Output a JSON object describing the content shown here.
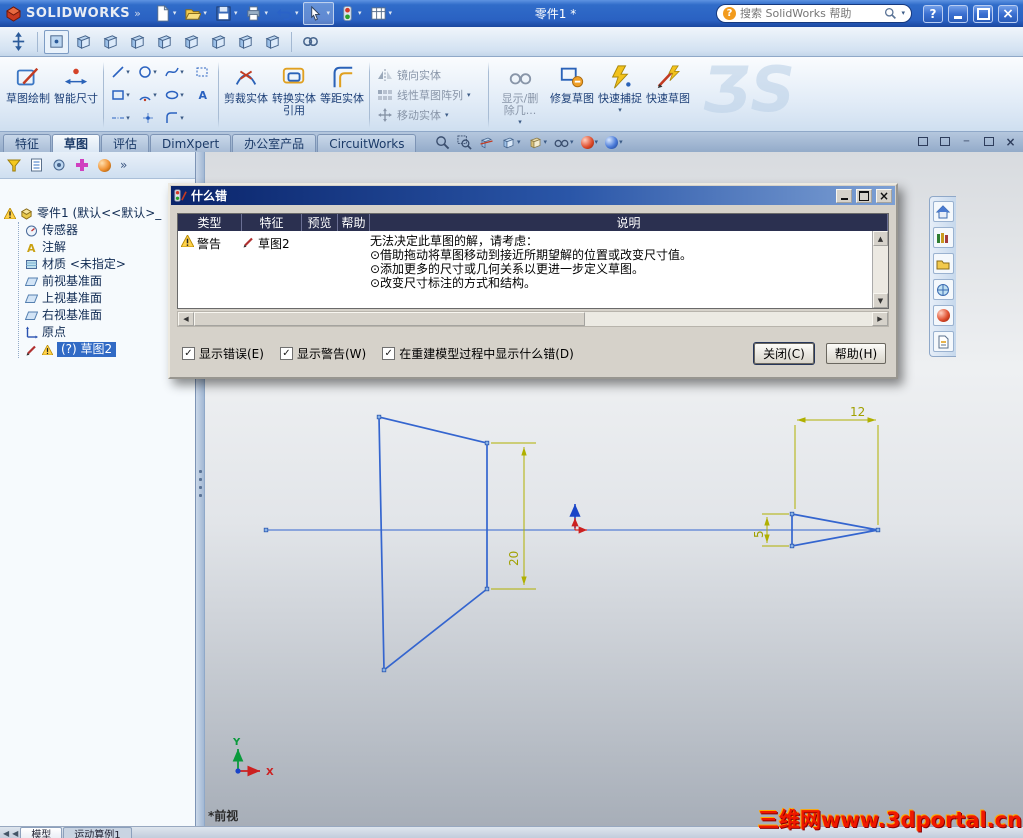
{
  "titlebar": {
    "brand": "SOLIDWORKS",
    "doc_title": "零件1 *",
    "search_placeholder": "搜索 SolidWorks 帮助"
  },
  "icons": {
    "help_badge": "?",
    "caret": "▾",
    "chevron": "»",
    "close": "×",
    "check": "✓",
    "warning": "yellow-triangle-exclamation",
    "search": "magnifier",
    "rebuild": "traffic-light"
  },
  "colors": {
    "titlebar_blue": "#2a61c2",
    "selection_blue": "#316ac5",
    "geometry_blue": "#3465cf",
    "dimension_yellow": "#b0b000",
    "warning_yellow": "#f4c81e",
    "watermark_red": "#f01800"
  },
  "ribbon": {
    "sketch": "草图绘制",
    "smart_dimension": "智能尺寸",
    "trim_entities": "剪裁实体",
    "convert_entities": "转换实体引用",
    "offset_entities": "等距实体",
    "mirror_entities": "镜向实体",
    "linear_sketch_pattern": "线性草图阵列",
    "move_entities": "移动实体",
    "display_delete_relations": "显示/删除几...",
    "repair_sketch": "修复草图",
    "quick_snaps": "快速捕捉",
    "rapid_sketch": "快速草图"
  },
  "tabs": {
    "items": [
      "特征",
      "草图",
      "评估",
      "DimXpert",
      "办公室产品",
      "CircuitWorks"
    ],
    "active": "草图"
  },
  "feature_tree": {
    "root": "零件1 (默认<<默认>_",
    "items": [
      "传感器",
      "注解",
      "材质 <未指定>",
      "前视基准面",
      "上视基准面",
      "右视基准面",
      "原点",
      "(?) 草图2"
    ]
  },
  "dialog": {
    "title": "什么错",
    "columns": [
      "类型",
      "特征",
      "预览",
      "帮助",
      "说明"
    ],
    "row_type": "警告",
    "row_feature": "草图2",
    "description": [
      "无法决定此草图的解，请考虑：",
      "⊙借助拖动将草图移动到接近所期望解的位置或改变尺寸值。",
      "⊙添加更多的尺寸或几何关系以更进一步定义草图。",
      "⊙改变尺寸标注的方式和结构。"
    ],
    "checkbox_errors": "显示错误(E)",
    "checkbox_warnings": "显示警告(W)",
    "checkbox_rebuild": "在重建模型过程中显示什么错(D)",
    "close_button": "关闭(C)",
    "help_button": "帮助(H)"
  },
  "graphics": {
    "view_label": "*前视",
    "dimensions": {
      "trapezoid_height": "20",
      "triangle_width": "12",
      "triangle_height": "5"
    },
    "triad": {
      "x": "X",
      "y": "Y"
    }
  },
  "bottom_tabs": [
    "模型",
    "运动算例1"
  ],
  "decor": {
    "ds_logo": "ƷS"
  },
  "watermark": "三维网www.3dportal.cn"
}
